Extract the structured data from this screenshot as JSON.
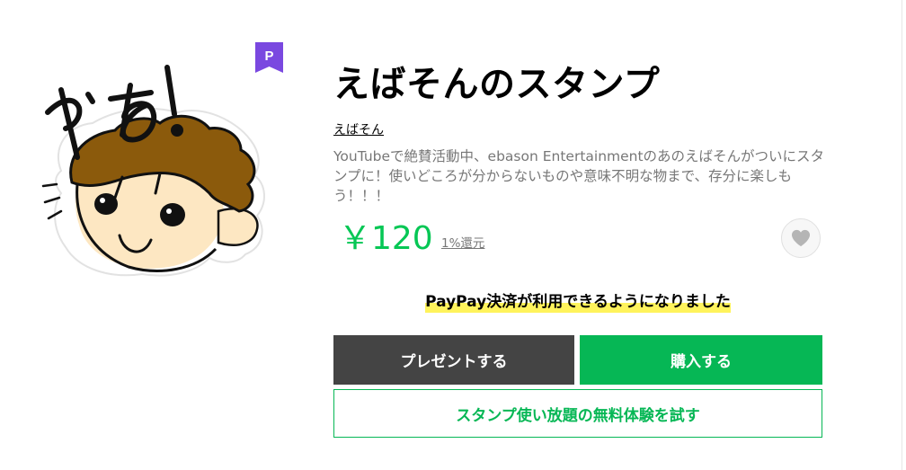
{
  "sticker": {
    "image_name": "yaa-sticker",
    "handwritten_text": "やぁ!"
  },
  "badge": {
    "letter": "P",
    "color": "#7a48e0"
  },
  "title": "えばそんのスタンプ",
  "author": "えばそん",
  "description": "YouTubeで絶賛活動中、ebason Entertainmentのあのえばそんがついにスタンプに！使いどころが分からないものや意味不明な物まで、存分に楽しもう！！！",
  "price": "￥120",
  "reward": "1%還元",
  "favorite": {
    "icon": "heart-icon"
  },
  "notice": "PayPay決済が利用できるようになりました",
  "buttons": {
    "present": "プレゼントする",
    "buy": "購入する",
    "trial": "スタンプ使い放題の無料体験を試す"
  },
  "colors": {
    "accent_green": "#06b755",
    "present_button": "#444444",
    "highlight_yellow": "#fff35c",
    "premium_purple": "#7a48e0"
  }
}
